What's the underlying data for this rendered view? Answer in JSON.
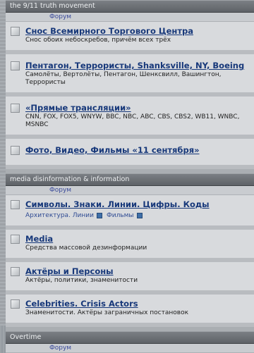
{
  "categories": [
    {
      "title": "the 9/11 truth movement",
      "col_label": "Форум",
      "forums": [
        {
          "title": "Снос Всемирного Торгового Центра",
          "desc": "Снос обоих небоскребов, причём всех трёх"
        },
        {
          "title": "Пентагон, Террористы, Shanksville, NY, Boeing",
          "desc": "Самолёты, Вертолёты, Пентагон, Шенксвилл, Вашингтон, Террористы"
        },
        {
          "title": "«Прямые трансляции»",
          "desc": "CNN, FOX, FOX5, WNYW, BBC, NBC, ABC, CBS, CBS2, WB11, WNBC, MSNBC"
        },
        {
          "title": "Фото, Видео, Фильмы «11 сентября»",
          "desc": ""
        }
      ]
    },
    {
      "title": "media disinformation & information",
      "col_label": "Форум",
      "forums": [
        {
          "title": "Символы. Знаки. Линии. Цифры. Коды",
          "desc": "",
          "subforums": [
            "Архитектура. Линии",
            "Фильмы"
          ]
        },
        {
          "title": "Media",
          "desc": "Средства массовой дезинформации"
        },
        {
          "title": "Актёры и Персоны",
          "desc": "Актёры, политики, знаменитости"
        },
        {
          "title": "Celebrities. Crisis Actors",
          "desc": "Знаменитости. Актёры заграничных постановок"
        }
      ]
    },
    {
      "title": "Overtime",
      "col_label": "Форум",
      "forums": []
    }
  ]
}
